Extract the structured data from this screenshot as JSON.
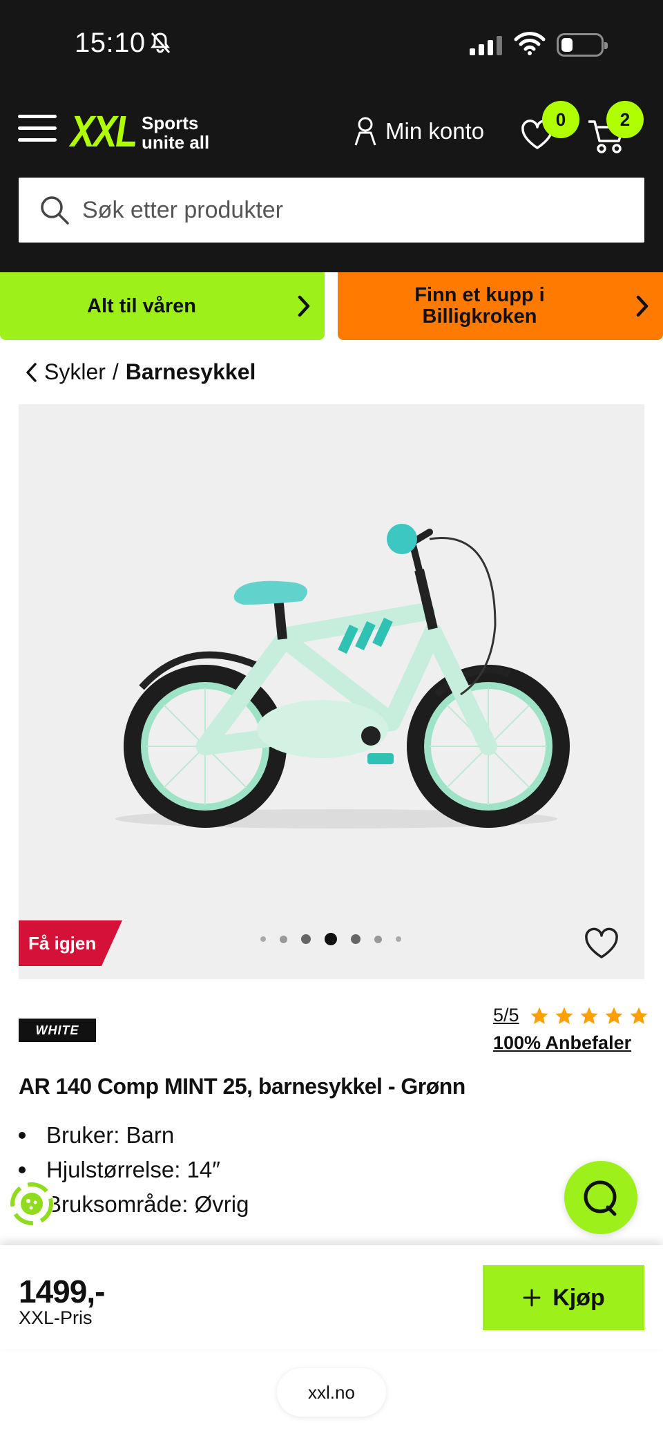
{
  "status_bar": {
    "time": "15:10"
  },
  "header": {
    "logo": "XXL",
    "tagline_line1": "Sports",
    "tagline_line2": "unite all",
    "account_label": "Min konto",
    "wishlist_count": "0",
    "cart_count": "2",
    "search_placeholder": "Søk etter produkter",
    "accent_color": "#b0ff00"
  },
  "promos": [
    {
      "label": "Alt til våren",
      "color": "#9ef01a"
    },
    {
      "label_line1": "Finn et kupp i",
      "label_line2": "Billigkroken",
      "color": "#ff7a00"
    }
  ],
  "breadcrumb": {
    "parent": "Sykler",
    "separator": "/",
    "current": "Barnesykkel"
  },
  "gallery": {
    "badge": "Få igjen",
    "badge_color": "#d41137",
    "image_count": 7,
    "active_index": 3
  },
  "product": {
    "brand": "WHITE",
    "rating": "5/5",
    "stars": 5,
    "recommend": "100% Anbefaler",
    "title": "AR 140 Comp MINT 25, barnesykkel - Grønn",
    "specs": [
      "Bruker: Barn",
      "Hjulstørrelse: 14″",
      "Bruksområde: Øvrig"
    ]
  },
  "buy_bar": {
    "price": "1499,-",
    "price_label": "XXL-Pris",
    "buy_label": "Kjøp"
  },
  "browser": {
    "url": "xxl.no"
  }
}
